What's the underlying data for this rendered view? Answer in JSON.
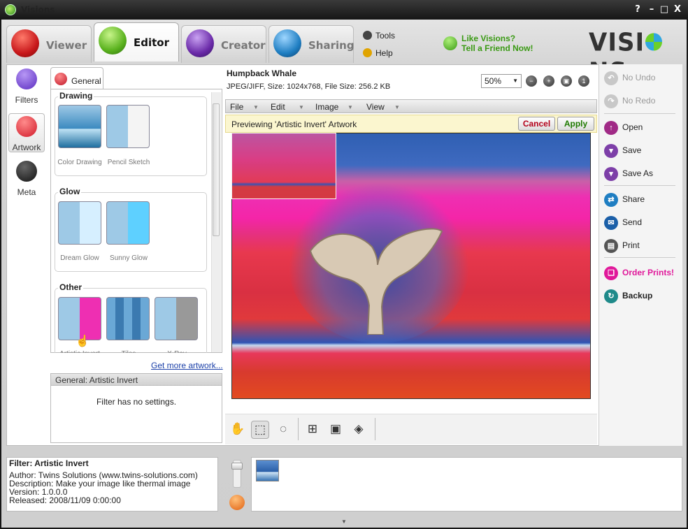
{
  "window": {
    "title": "Visions",
    "controls": [
      "?",
      "–",
      "□",
      "X"
    ]
  },
  "tabs": [
    {
      "label": "Viewer",
      "color": "#c8181b"
    },
    {
      "label": "Editor",
      "color": "#5ab21e"
    },
    {
      "label": "Creator",
      "color": "#6a2aa8"
    },
    {
      "label": "Sharing",
      "color": "#1f7ec2"
    }
  ],
  "header_links": {
    "tools": "Tools",
    "help": "Help"
  },
  "promo": {
    "line1": "Like Visions?",
    "line2": "Tell a Friend Now!"
  },
  "brand": {
    "left": "VISI",
    "right": "NS"
  },
  "sidebar": [
    {
      "label": "Filters",
      "icon": "forward-icon"
    },
    {
      "label": "Artwork",
      "icon": "palette-icon"
    },
    {
      "label": "Meta",
      "icon": "document-icon"
    }
  ],
  "subtab": {
    "label": "General"
  },
  "groups": [
    {
      "title": "Drawing",
      "items": [
        "Color Drawing",
        "Pencil Sketch"
      ]
    },
    {
      "title": "Glow",
      "items": [
        "Dream Glow",
        "Sunny Glow"
      ]
    },
    {
      "title": "Other",
      "items": [
        "Artistic Invert",
        "Tiles",
        "X-Ray"
      ]
    }
  ],
  "get_more": "Get more artwork...",
  "settings": {
    "header": "General: Artistic Invert",
    "body": "Filter has no settings."
  },
  "image": {
    "title": "Humpback Whale",
    "meta": "JPEG/JIFF, Size: 1024x768, File Size: 256.2 KB"
  },
  "zoom": {
    "value": "50%"
  },
  "menu": [
    "File",
    "Edit",
    "Image",
    "View"
  ],
  "preview": {
    "text": "Previewing 'Artistic Invert' Artwork",
    "cancel": "Cancel",
    "apply": "Apply"
  },
  "actions": {
    "undo": "No Undo",
    "redo": "No Redo",
    "open": "Open",
    "save": "Save",
    "save_as": "Save As",
    "share": "Share",
    "send": "Send",
    "print": "Print",
    "order": "Order Prints!",
    "backup": "Backup"
  },
  "filter_info": {
    "title": "Filter: Artistic Invert",
    "author": "Author: Twins Solutions (www.twins-solutions.com)",
    "description": "Description: Make your image like thermal image",
    "version": "Version: 1.0.0.0",
    "released": "Released: 2008/11/09 0:00:00"
  },
  "colors": {
    "accent_green": "#3a9a14",
    "order_pink": "#e0189a",
    "link_blue": "#1a3fa8"
  }
}
